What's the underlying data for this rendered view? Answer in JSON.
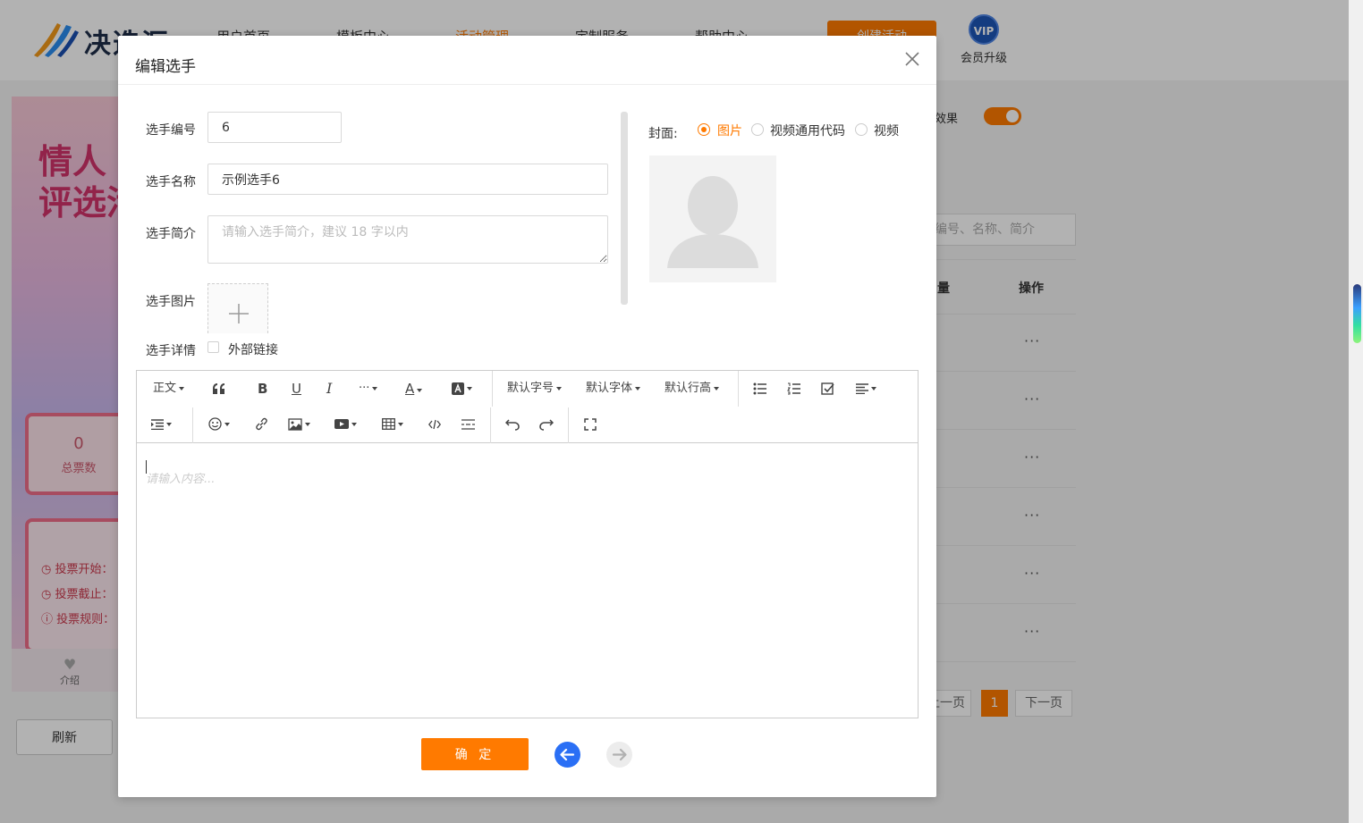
{
  "background": {
    "logo_text": "决选汇",
    "nav": [
      "用户首页",
      "模板中心",
      "活动管理",
      "定制服务",
      "帮助中心"
    ],
    "nav_active_index": 2,
    "create_button": "创建活动",
    "vip_badge": "VIP",
    "vip_label": "会员升级",
    "preview": {
      "title_line1": "情人",
      "title_line2": "评选活",
      "total_votes_value": "0",
      "total_votes_label": "总票数",
      "vote_start": "投票开始：",
      "vote_end": "投票截止：",
      "vote_rules": "投票规则：",
      "tab_intro": "介绍"
    },
    "refresh_button": "刷新",
    "effect_label": "效果",
    "search_placeholder": "编号、名称、简介",
    "col_votes": "量",
    "col_action": "操作",
    "row_action": "···",
    "prev_page": "上一页",
    "current_page": "1",
    "next_page": "下一页"
  },
  "modal": {
    "title": "编辑选手",
    "fields": {
      "number_label": "选手编号",
      "number_value": "6",
      "name_label": "选手名称",
      "name_value": "示例选手6",
      "intro_label": "选手简介",
      "intro_placeholder": "请输入选手简介，建议 18 字以内",
      "image_label": "选手图片",
      "detail_label": "选手详情",
      "external_link_label": "外部链接"
    },
    "cover": {
      "label": "封面:",
      "options": [
        "图片",
        "视频通用代码",
        "视频"
      ],
      "selected_index": 0
    },
    "editor": {
      "toolbar": {
        "paragraph": "正文",
        "font_size": "默认字号",
        "font_family": "默认字体",
        "line_height": "默认行高"
      },
      "placeholder": "请输入内容..."
    },
    "ok_button": "确 定"
  },
  "colors": {
    "accent": "#ff7a00",
    "nav_prev": "#2a6ff5",
    "nav_next_disabled": "#ececec"
  }
}
